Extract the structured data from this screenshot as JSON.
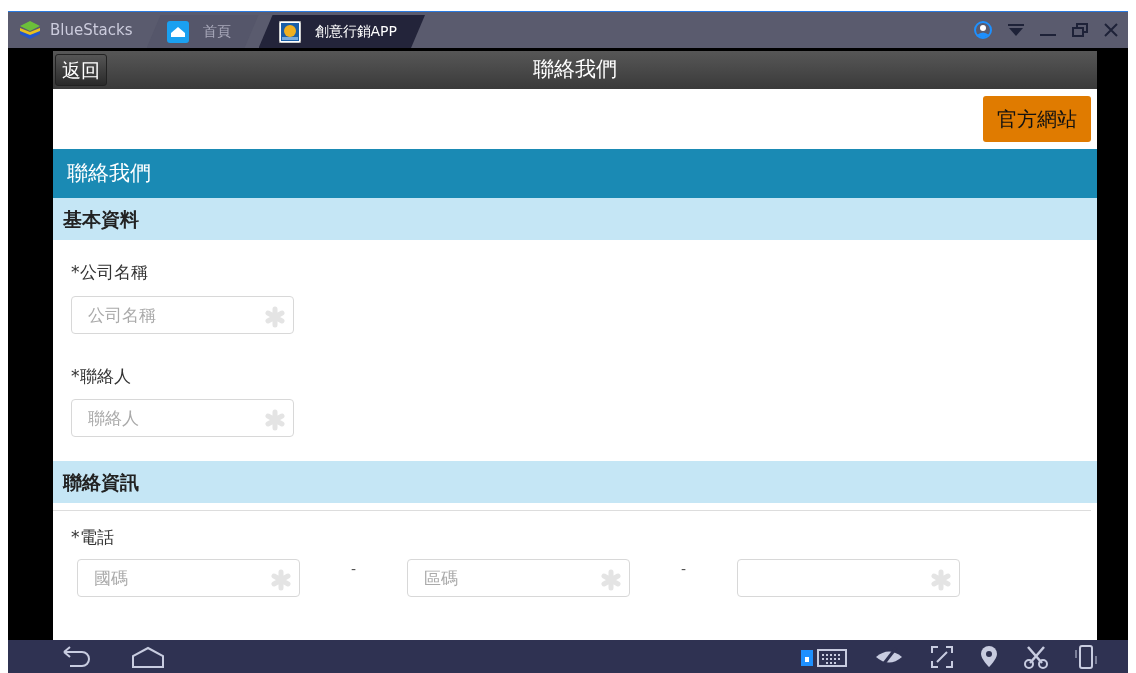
{
  "window": {
    "brand": "BlueStacks",
    "tabs": [
      {
        "label": "首頁",
        "selected": false,
        "kind": "home"
      },
      {
        "label": "創意行銷APP",
        "selected": true,
        "kind": "app"
      }
    ]
  },
  "app": {
    "back_button": "返回",
    "title": "聯絡我們",
    "site_button": "官方網站",
    "section_title": "聯絡我們",
    "groups": [
      {
        "heading": "基本資料",
        "fields": [
          {
            "label": "*公司名稱",
            "placeholder": "公司名稱",
            "required": true
          },
          {
            "label": "*聯絡人",
            "placeholder": "聯絡人",
            "required": true
          }
        ]
      },
      {
        "heading": "聯絡資訊",
        "phone": {
          "label": "*電話",
          "separators": [
            "-",
            "-"
          ],
          "fields": [
            {
              "placeholder": "國碼",
              "required": true
            },
            {
              "placeholder": "區碼",
              "required": true
            },
            {
              "required": true
            }
          ]
        }
      }
    ]
  }
}
